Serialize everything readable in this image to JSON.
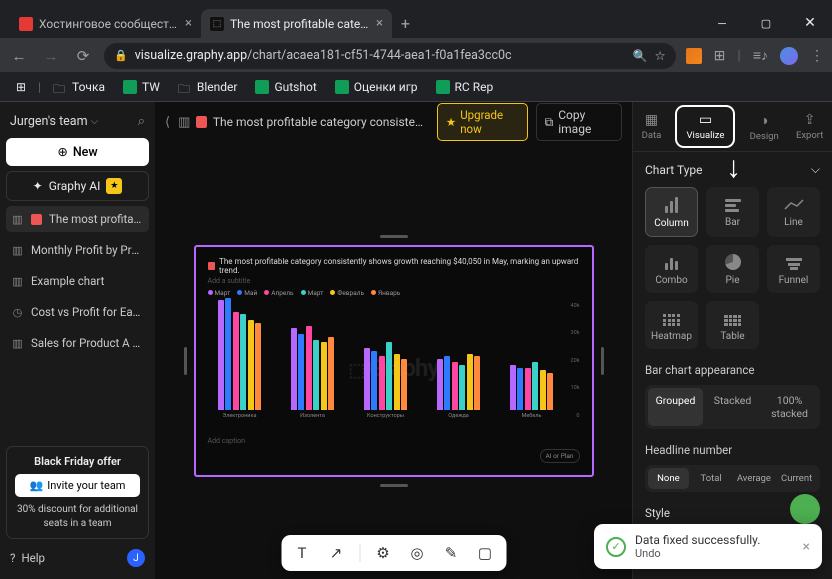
{
  "browser": {
    "tabs": [
      {
        "title": "Хостинговое сообщество «Tin",
        "favicon": "#e53935"
      },
      {
        "title": "The most profitable catego",
        "favicon": "#7c4dff",
        "active": true
      }
    ],
    "url_domain": "visualize.graphy.app",
    "url_path": "/chart/acaea181-cf51-4744-aea1-f0a1fea3cc0c",
    "bookmarks": [
      "Точка",
      "TW",
      "Blender",
      "Gutshot",
      "Оценки игр",
      "RC Rep"
    ]
  },
  "sidebar": {
    "team": "Jurgen's team",
    "new_label": "New",
    "graphy_ai": "Graphy AI",
    "items": [
      {
        "label": "The most profitable ...",
        "icon": "check",
        "active": true
      },
      {
        "label": "Monthly Profit by Produ...",
        "icon": "bar"
      },
      {
        "label": "Example chart",
        "icon": "bar"
      },
      {
        "label": "Cost vs Profit for Each ...",
        "icon": "clock"
      },
      {
        "label": "Sales for Product A hav...",
        "icon": "bar"
      }
    ],
    "offer_title": "Black Friday offer",
    "invite_label": "Invite your team",
    "offer_sub": "30% discount for additional seats in a team",
    "help": "Help",
    "avatar_letter": "J"
  },
  "topbar": {
    "title": "The most profitable category consistently sh...",
    "upgrade": "Upgrade now",
    "copy": "Copy image"
  },
  "rightpanel": {
    "tabs": [
      "Data",
      "Visualize",
      "Design",
      "Export"
    ],
    "active_tab": "Visualize",
    "chart_type_title": "Chart Type",
    "types": [
      "Column",
      "Bar",
      "Line",
      "Combo",
      "Pie",
      "Funnel",
      "Heatmap",
      "Table"
    ],
    "selected_type": "Column",
    "appearance_title": "Bar chart appearance",
    "appearance_opts": [
      "Grouped",
      "Stacked",
      "100% stacked"
    ],
    "appearance_selected": "Grouped",
    "headline_title": "Headline number",
    "headline_opts": [
      "None",
      "Total",
      "Average",
      "Current"
    ],
    "headline_selected": "None",
    "style_title": "Style"
  },
  "chart_data": {
    "type": "bar",
    "title": "The most profitable category consistently shows growth reaching $40,050 in May, marking an upward trend.",
    "subtitle": "Add a subtitle",
    "caption": "Add caption",
    "ai_chip": "AI or Plan",
    "watermark": "Graphy",
    "categories": [
      "Электроника",
      "Изолента",
      "Конструкторы",
      "Одежда",
      "Мебель"
    ],
    "series": [
      {
        "name": "Март",
        "color": "#b768ff",
        "values": [
          39,
          29,
          22,
          18,
          16
        ]
      },
      {
        "name": "Май",
        "color": "#2e7bff",
        "values": [
          40,
          27,
          21,
          19,
          15
        ]
      },
      {
        "name": "Апрель",
        "color": "#ff46a1",
        "values": [
          35,
          30,
          19,
          17,
          15
        ]
      },
      {
        "name": "Март",
        "color": "#3ad1c9",
        "values": [
          34,
          25,
          24,
          16,
          17
        ]
      },
      {
        "name": "Февраль",
        "color": "#f5c518",
        "values": [
          32,
          24,
          20,
          20,
          14
        ]
      },
      {
        "name": "Январь",
        "color": "#ff8a3d",
        "values": [
          31,
          26,
          18,
          19,
          13
        ]
      }
    ],
    "ylim": [
      0,
      40
    ],
    "yticks": [
      "40k",
      "30k",
      "20k",
      "10k",
      "0"
    ]
  },
  "toast": {
    "message": "Data fixed successfully.",
    "action": "Undo"
  },
  "toolbar": {
    "items": [
      "T",
      "↗",
      "⚙",
      "◎",
      "✎",
      "▢"
    ]
  }
}
